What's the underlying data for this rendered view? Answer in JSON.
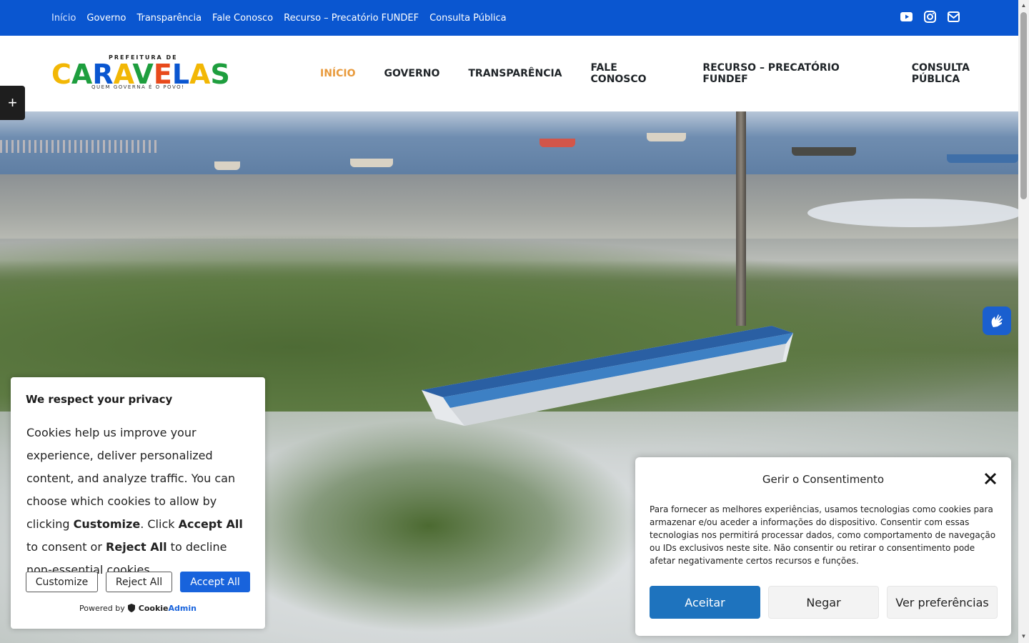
{
  "topbar": {
    "links": [
      "Início",
      "Governo",
      "Transparência",
      "Fale Conosco",
      "Recurso – Precatório FUNDEF",
      "Consulta Pública"
    ],
    "social_icons": [
      "youtube-icon",
      "instagram-icon",
      "envelope-icon"
    ],
    "bg_color": "#0a56d0"
  },
  "logo": {
    "pre": "PREFEITURA DE",
    "main": "CARAVELAS",
    "sub": "QUEM GOVERNA É O POVO!"
  },
  "mainnav": {
    "items": [
      "INÍCIO",
      "GOVERNO",
      "TRANSPARÊNCIA",
      "FALE CONOSCO",
      "RECURSO – PRECATÓRIO FUNDEF",
      "CONSULTA PÚBLICA"
    ],
    "active_color": "#e89a3c"
  },
  "sidetoggle": {
    "label": "+"
  },
  "cookie": {
    "title": "We respect your privacy",
    "text_part1": "Cookies help us improve your experience, deliver personalized content, and analyze traffic. You can choose which cookies to allow by clicking ",
    "text_customize": "Customize",
    "text_part2": ". Click ",
    "text_accept": "Accept All",
    "text_part3": " to consent or ",
    "text_reject": "Reject All",
    "text_part4": " to decline non-essential cookies.",
    "btn_customize": "Customize",
    "btn_reject": "Reject All",
    "btn_accept": "Accept All",
    "powered_by": "Powered by",
    "brand_a": "Cookie",
    "brand_b": "Admin"
  },
  "consent": {
    "title": "Gerir o Consentimento",
    "body": "Para fornecer as melhores experiências, usamos tecnologias como cookies para armazenar e/ou aceder a informações do dispositivo. Consentir com essas tecnologias nos permitirá processar dados, como comportamento de navegação ou IDs exclusivos neste site. Não consentir ou retirar o consentimento pode afetar negativamente certos recursos e funções.",
    "btn_accept": "Aceitar",
    "btn_deny": "Negar",
    "btn_prefs": "Ver preferências"
  }
}
